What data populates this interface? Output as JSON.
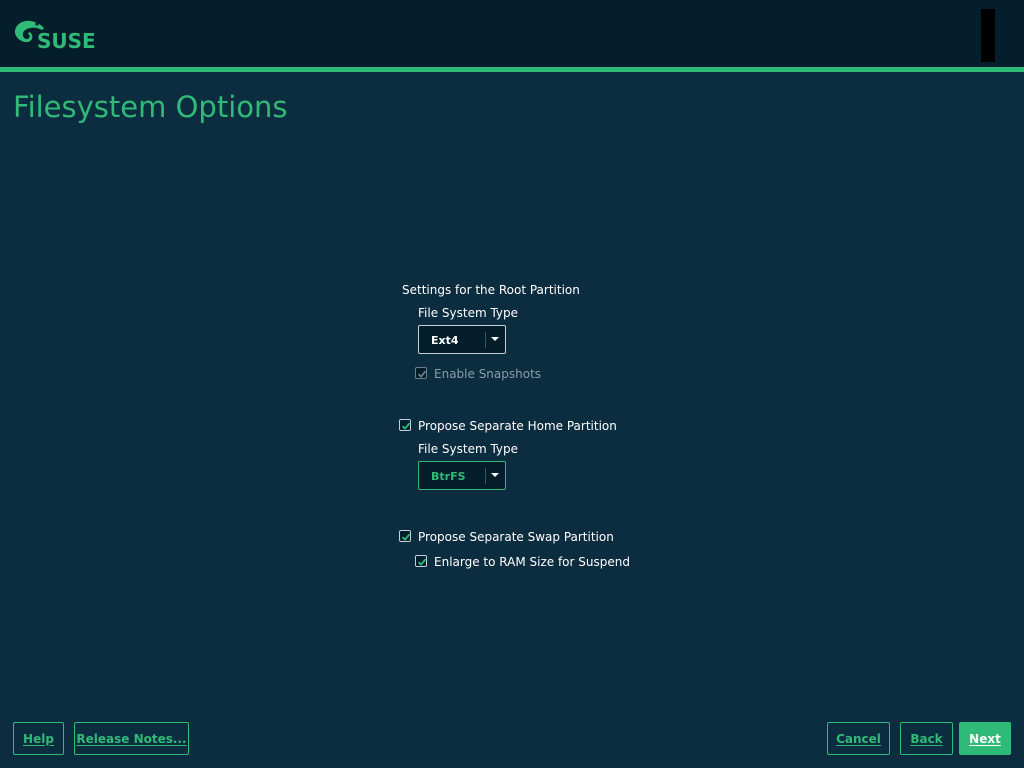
{
  "header": {
    "logo_text": "SUSE",
    "title": "Filesystem Options"
  },
  "root_partition": {
    "section_label": "Settings for the Root Partition",
    "fs_type_label": "File System Type",
    "fs_type_value": "Ext4",
    "snapshots_label": "Enable Snapshots",
    "snapshots_checked": true,
    "snapshots_enabled": false
  },
  "home_partition": {
    "propose_label": "Propose Separate Home Partition",
    "propose_checked": true,
    "fs_type_label": "File System Type",
    "fs_type_value": "BtrFS"
  },
  "swap_partition": {
    "propose_label": "Propose Separate Swap Partition",
    "propose_checked": true,
    "enlarge_label": "Enlarge to RAM Size for Suspend",
    "enlarge_checked": true
  },
  "footer": {
    "help_label": "Help",
    "release_notes_label": "Release Notes...",
    "cancel_label": "Cancel",
    "back_label": "Back",
    "next_label": "Next"
  },
  "colors": {
    "accent": "#30ba78",
    "background": "#0c2c40",
    "header_background": "#041e2b"
  },
  "icons": {
    "logo": "suse-chameleon-logo",
    "dropdown": "chevron-down-icon",
    "check": "check-icon"
  }
}
